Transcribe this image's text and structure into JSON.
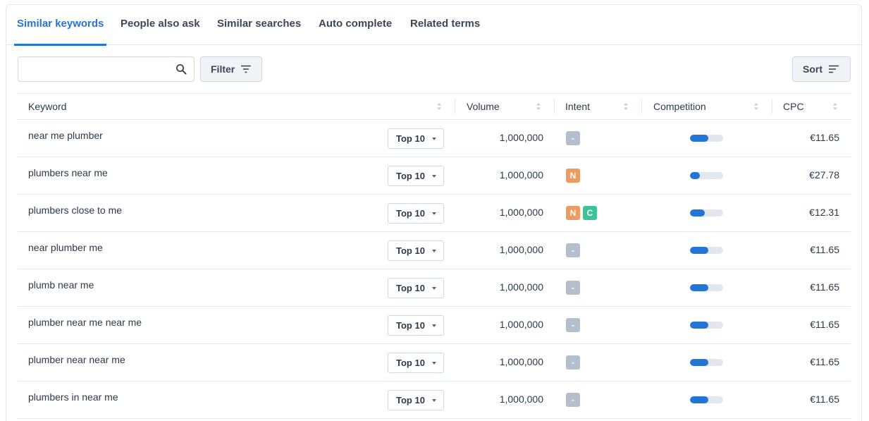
{
  "tabs": [
    {
      "label": "Similar keywords",
      "active": true
    },
    {
      "label": "People also ask",
      "active": false
    },
    {
      "label": "Similar searches",
      "active": false
    },
    {
      "label": "Auto complete",
      "active": false
    },
    {
      "label": "Related terms",
      "active": false
    }
  ],
  "toolbar": {
    "search_value": "",
    "filter_label": "Filter",
    "sort_label": "Sort"
  },
  "icons": {
    "search": "search-icon",
    "filter": "filter-lines-icon",
    "sort": "sort-lines-icon",
    "column_sort": "sort-arrows-icon",
    "dropdown": "caret-down-icon"
  },
  "colors": {
    "accent": "#2474d6",
    "intent_navigational": "#ee9a61",
    "intent_commercial": "#3fc19a",
    "intent_none": "#b3bfcc"
  },
  "table": {
    "columns": {
      "keyword": "Keyword",
      "volume": "Volume",
      "intent": "Intent",
      "competition": "Competition",
      "cpc": "CPC"
    },
    "rows": [
      {
        "keyword": "near me plumber",
        "rank": "Top 10",
        "volume": "1,000,000",
        "intents": [
          "-"
        ],
        "competition": 0.55,
        "cpc": "€11.65"
      },
      {
        "keyword": "plumbers near me",
        "rank": "Top 10",
        "volume": "1,000,000",
        "intents": [
          "N"
        ],
        "competition": 0.3,
        "cpc": "€27.78"
      },
      {
        "keyword": "plumbers close to me",
        "rank": "Top 10",
        "volume": "1,000,000",
        "intents": [
          "N",
          "C"
        ],
        "competition": 0.45,
        "cpc": "€12.31"
      },
      {
        "keyword": "near plumber me",
        "rank": "Top 10",
        "volume": "1,000,000",
        "intents": [
          "-"
        ],
        "competition": 0.55,
        "cpc": "€11.65"
      },
      {
        "keyword": "plumb near me",
        "rank": "Top 10",
        "volume": "1,000,000",
        "intents": [
          "-"
        ],
        "competition": 0.55,
        "cpc": "€11.65"
      },
      {
        "keyword": "plumber near me near me",
        "rank": "Top 10",
        "volume": "1,000,000",
        "intents": [
          "-"
        ],
        "competition": 0.55,
        "cpc": "€11.65"
      },
      {
        "keyword": "plumber near near me",
        "rank": "Top 10",
        "volume": "1,000,000",
        "intents": [
          "-"
        ],
        "competition": 0.55,
        "cpc": "€11.65"
      },
      {
        "keyword": "plumbers in near me",
        "rank": "Top 10",
        "volume": "1,000,000",
        "intents": [
          "-"
        ],
        "competition": 0.55,
        "cpc": "€11.65"
      }
    ]
  }
}
